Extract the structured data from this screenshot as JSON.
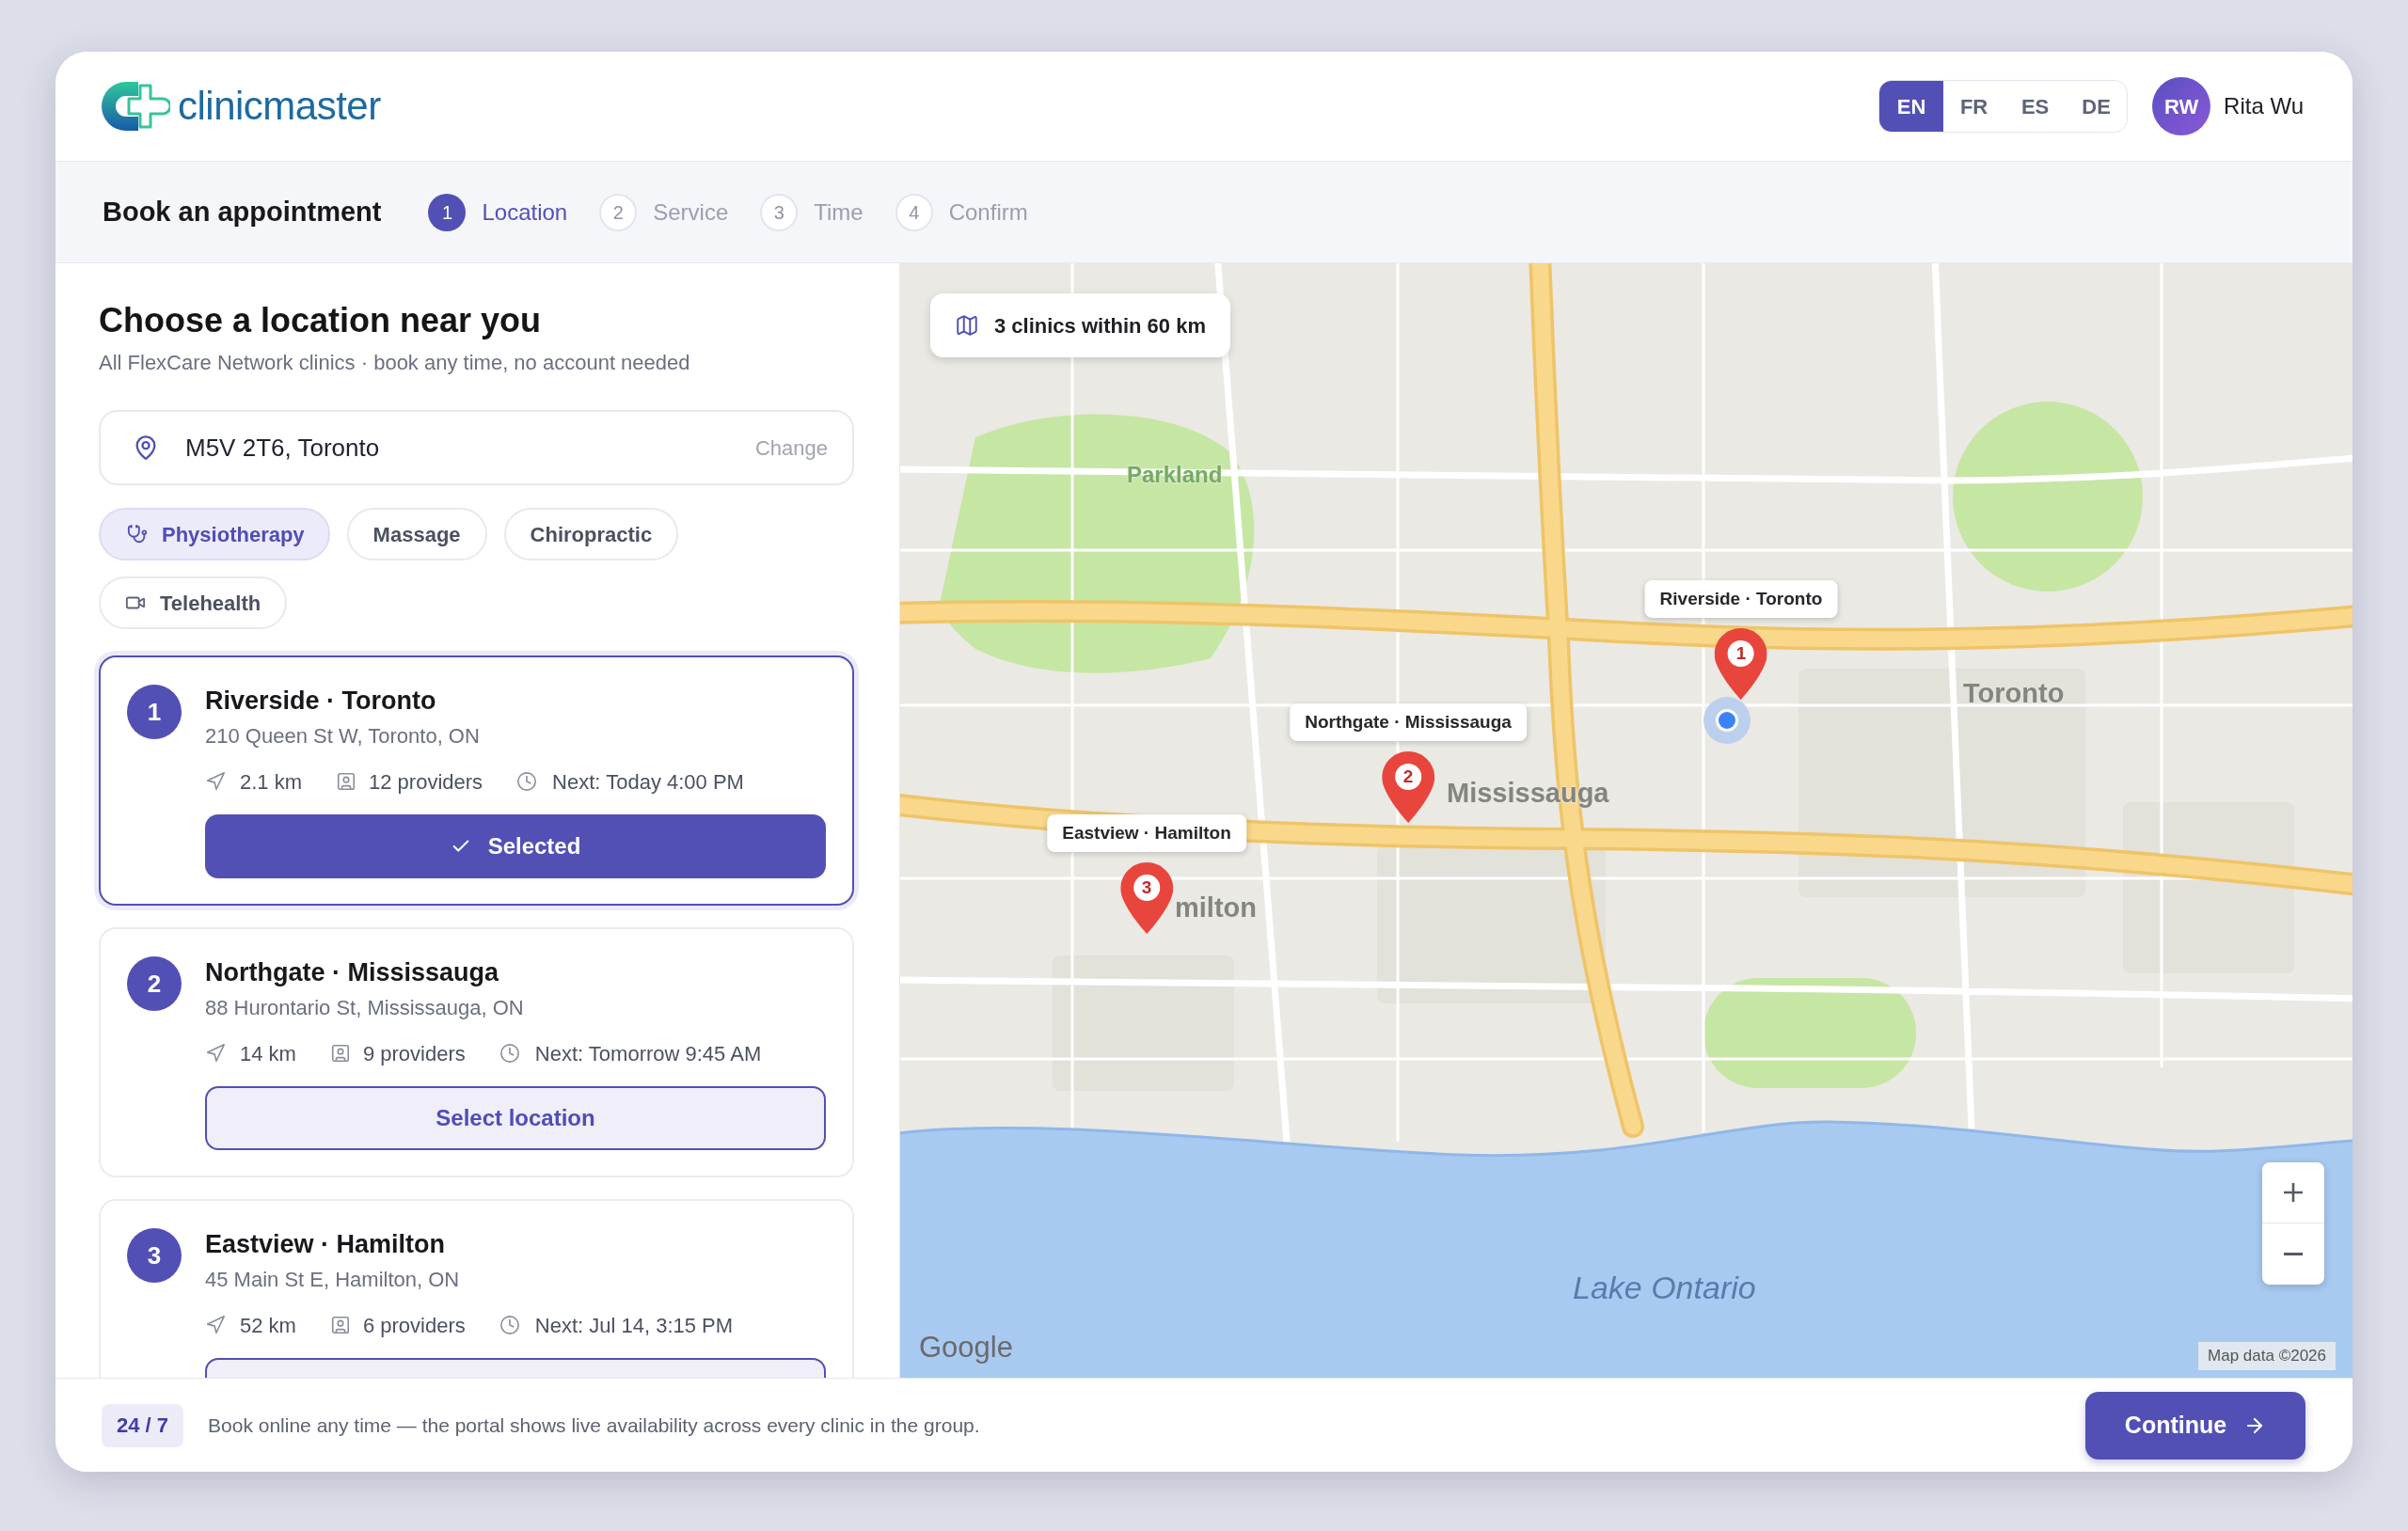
{
  "header": {
    "logo_text": "clinicmaster",
    "languages": [
      {
        "code": "EN",
        "selected": true
      },
      {
        "code": "FR",
        "selected": false
      },
      {
        "code": "ES",
        "selected": false
      },
      {
        "code": "DE",
        "selected": false
      }
    ],
    "user": {
      "initials": "RW",
      "name": "Rita Wu"
    }
  },
  "stepper": {
    "title": "Book an appointment",
    "steps": [
      {
        "number": "1",
        "label": "Location",
        "selected": true
      },
      {
        "number": "2",
        "label": "Service",
        "selected": false
      },
      {
        "number": "3",
        "label": "Time",
        "selected": false
      },
      {
        "number": "4",
        "label": "Confirm",
        "selected": false
      }
    ]
  },
  "location_panel": {
    "title": "Choose a location near you",
    "subtitle": "All FlexCare Network clinics · book any time, no account needed",
    "search": {
      "value": "M5V 2T6, Toronto",
      "action": "Change"
    },
    "filters": [
      {
        "label": "Physiotherapy",
        "selected": true
      },
      {
        "label": "Massage",
        "selected": false
      },
      {
        "label": "Chiropractic",
        "selected": false
      },
      {
        "label": "Telehealth",
        "selected": false
      }
    ],
    "clinics": [
      {
        "number": "1",
        "name": "Riverside · Toronto",
        "address": "210 Queen St W, Toronto, ON",
        "distance": "2.1 km",
        "providers": "12 providers",
        "next": "Next: Today 4:00 PM",
        "selected": true,
        "button": "Selected"
      },
      {
        "number": "2",
        "name": "Northgate · Mississauga",
        "address": "88 Hurontario St, Mississauga, ON",
        "distance": "14 km",
        "providers": "9 providers",
        "next": "Next: Tomorrow 9:45 AM",
        "selected": false,
        "button": "Select location"
      },
      {
        "number": "3",
        "name": "Eastview · Hamilton",
        "address": "45 Main St E, Hamilton, ON",
        "distance": "52 km",
        "providers": "6 providers",
        "next": "Next: Jul 14, 3:15 PM",
        "selected": false
      }
    ]
  },
  "map": {
    "summary": "3 clinics within 60 km",
    "places": [
      {
        "label": "Parkland",
        "kind": "park"
      },
      {
        "label": "Toronto",
        "kind": "city"
      },
      {
        "label": "Mississauga",
        "kind": "city"
      },
      {
        "label": "milton",
        "kind": "city"
      },
      {
        "label": "Lake Ontario",
        "kind": "water"
      }
    ],
    "markers": [
      {
        "number": "1",
        "label": "Riverside · Toronto"
      },
      {
        "number": "2",
        "label": "Northgate · Mississauga"
      },
      {
        "number": "3",
        "label": "Eastview · Hamilton"
      }
    ],
    "attribution": "Google",
    "map_data": "Map data ©2026"
  },
  "footer": {
    "badge": "24 / 7",
    "note": "Book online any time — the portal shows live availability across every clinic in the group.",
    "button": "Continue"
  }
}
